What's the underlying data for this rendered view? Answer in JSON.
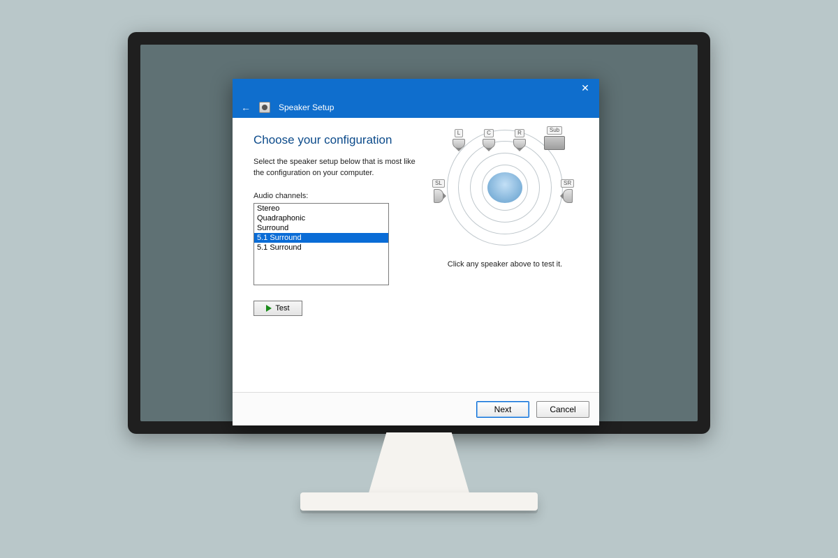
{
  "window": {
    "title": "Speaker Setup"
  },
  "dialog": {
    "heading": "Choose your configuration",
    "description": "Select the speaker setup below that is most like the configuration on your computer.",
    "list_label": "Audio channels:",
    "options": [
      "Stereo",
      "Quadraphonic",
      "Surround",
      "5.1 Surround",
      "5.1 Surround"
    ],
    "selected_index": 3,
    "test_label": "Test",
    "hint": "Click any speaker above to test it."
  },
  "diagram": {
    "speakers": {
      "L": "L",
      "C": "C",
      "R": "R",
      "SL": "SL",
      "SR": "SR",
      "Sub": "Sub"
    }
  },
  "footer": {
    "next": "Next",
    "cancel": "Cancel"
  }
}
